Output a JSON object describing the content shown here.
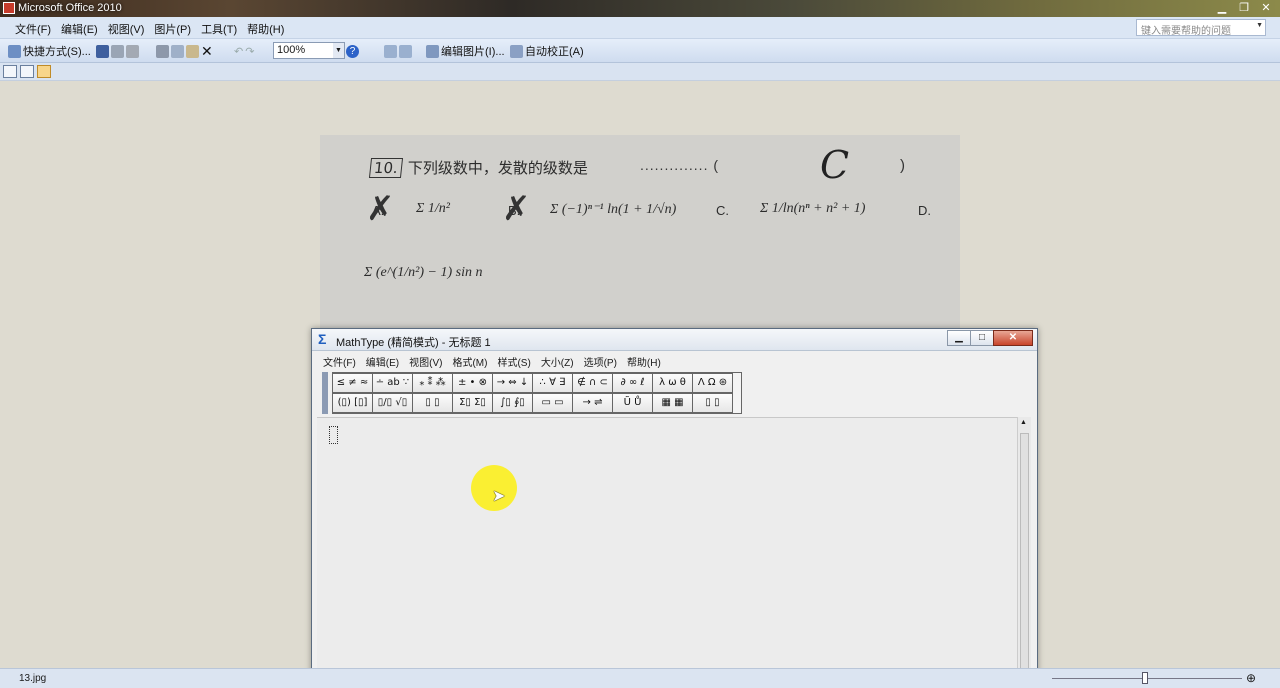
{
  "app": {
    "title": "Microsoft Office 2010"
  },
  "menu": {
    "items": [
      "文件(F)",
      "编辑(E)",
      "视图(V)",
      "图片(P)",
      "工具(T)",
      "帮助(H)"
    ],
    "help_placeholder": "键入需要帮助的问题"
  },
  "toolbar": {
    "shortcut": "快捷方式(S)...",
    "zoom": "100%",
    "edit_picture": "编辑图片(I)...",
    "auto_correct": "自动校正(A)"
  },
  "statusbar": {
    "filename": "13.jpg"
  },
  "question": {
    "number": "10.",
    "text": "下列级数中，发散的级数是",
    "dots": "..............  (",
    "answer": "C",
    "close_paren": ")",
    "option_a": "A.",
    "option_b": "B.",
    "option_c": "C.",
    "option_d": "D.",
    "expr_a": "Σ 1/n²",
    "expr_b": "Σ (−1)ⁿ⁻¹ ln(1 + 1/√n)",
    "expr_c": "Σ 1/ln(nⁿ + n² + 1)",
    "expr_d": "Σ (e^(1/n²) − 1) sin n"
  },
  "mathtype": {
    "title": "MathType (精简模式) - 无标题 1",
    "menu": [
      "文件(F)",
      "编辑(E)",
      "视图(V)",
      "格式(M)",
      "样式(S)",
      "大小(Z)",
      "选项(P)",
      "帮助(H)"
    ],
    "palette_row1": [
      "≤ ≠ ≈",
      "∸ ab ∵",
      "⁎ ⁑ ⁂",
      "± • ⊗",
      "→ ⇔ ↓",
      "∴ ∀ ∃",
      "∉ ∩ ⊂",
      "∂ ∞ ℓ",
      "λ ω θ",
      "Λ Ω ⊛"
    ],
    "palette_row2": [
      "(▯) [▯]",
      "▯/▯ √▯",
      "▯ ▯",
      "Σ▯ Σ▯",
      "∫▯ ∮▯",
      "▭ ▭",
      "→ ⇌",
      "Ũ Ů",
      "▦ ▦",
      "▯ ▯"
    ]
  }
}
